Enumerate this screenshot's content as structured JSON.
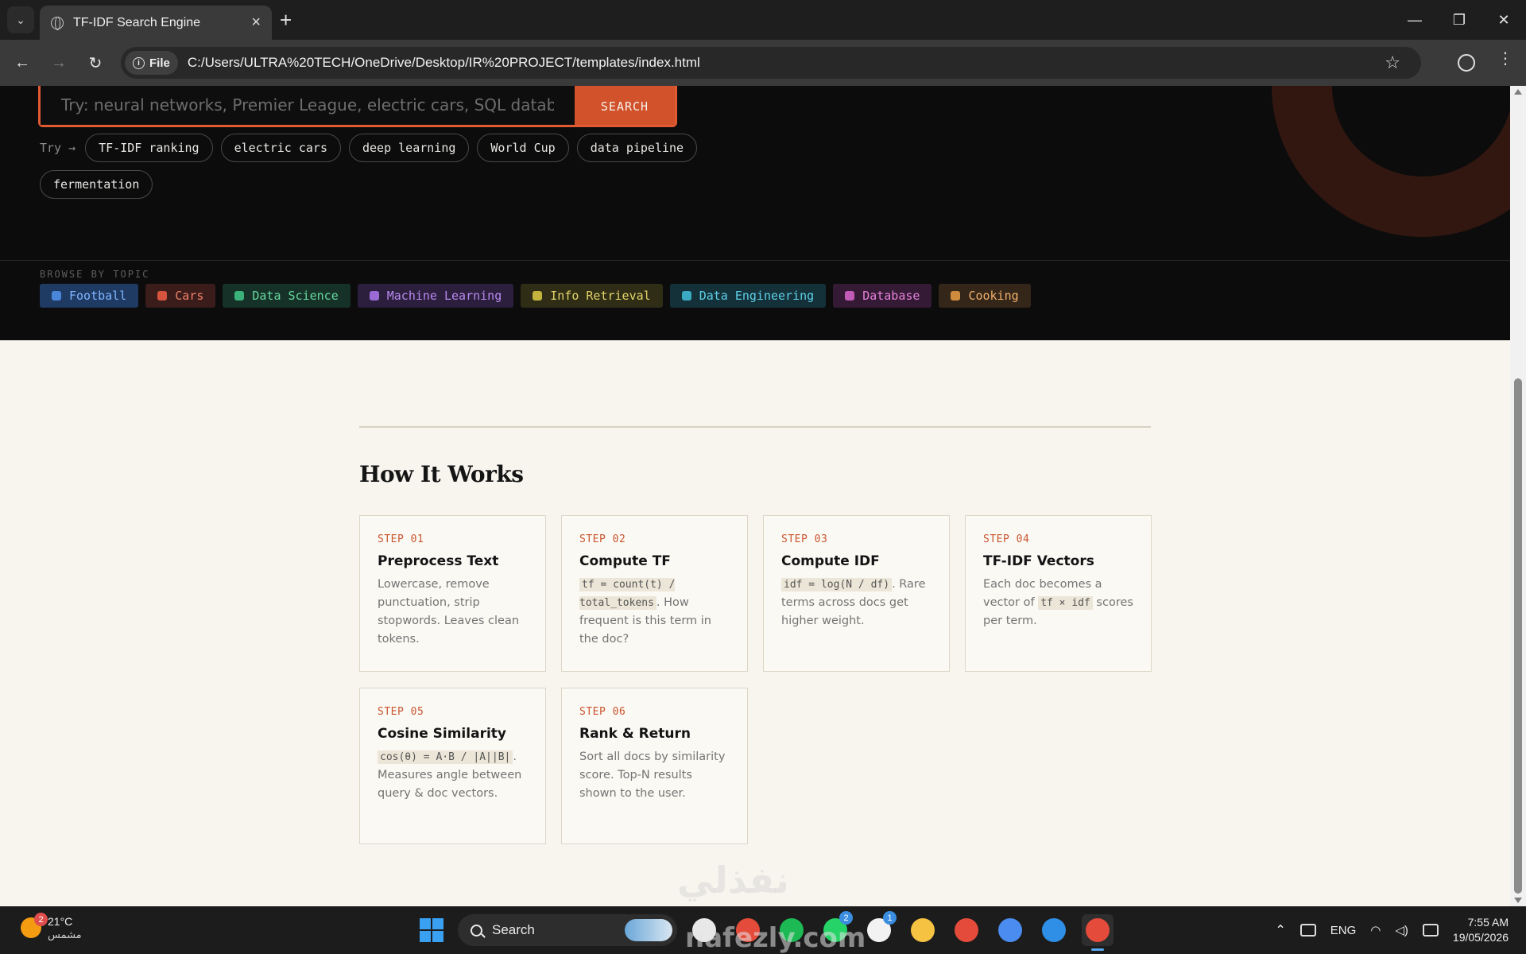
{
  "browser": {
    "tab_title": "TF-IDF Search Engine",
    "site_chip_label": "File",
    "url": "C:/Users/ULTRA%20TECH/OneDrive/Desktop/IR%20PROJECT/templates/index.html"
  },
  "search": {
    "placeholder": "Try: neural networks, Premier League, electric cars, SQL database...",
    "button_label": "SEARCH"
  },
  "try": {
    "label": "Try →",
    "chips": [
      "TF-IDF ranking",
      "electric cars",
      "deep learning",
      "World Cup",
      "data pipeline",
      "fermentation"
    ]
  },
  "browse": {
    "label": "BROWSE BY TOPIC",
    "topics": [
      {
        "label": "Football",
        "icon": "globe-icon",
        "bg": "#1f3a63",
        "fg": "#7fb6ff",
        "dot": "#4a86d9"
      },
      {
        "label": "Cars",
        "icon": "car-icon",
        "bg": "#3a1c1a",
        "fg": "#f0806a",
        "dot": "#d6543e"
      },
      {
        "label": "Data Science",
        "icon": "chart-icon",
        "bg": "#163228",
        "fg": "#67d89f",
        "dot": "#3bb27a"
      },
      {
        "label": "Machine Learning",
        "icon": "robot-icon",
        "bg": "#2c1f3d",
        "fg": "#b889ef",
        "dot": "#9a6ad6"
      },
      {
        "label": "Info Retrieval",
        "icon": "magnifier-icon",
        "bg": "#2f2d16",
        "fg": "#e4d46a",
        "dot": "#c4b43e"
      },
      {
        "label": "Data Engineering",
        "icon": "gear-icon",
        "bg": "#14313a",
        "fg": "#5ed0e6",
        "dot": "#3aa9c2"
      },
      {
        "label": "Database",
        "icon": "database-icon",
        "bg": "#351a35",
        "fg": "#e482d9",
        "dot": "#c25bb7"
      },
      {
        "label": "Cooking",
        "icon": "pan-icon",
        "bg": "#35261a",
        "fg": "#f0b06a",
        "dot": "#d08c3e"
      }
    ]
  },
  "how": {
    "title": "How It Works",
    "steps": [
      {
        "num": "STEP 01",
        "title": "Preprocess Text",
        "parts": [
          {
            "t": "Lowercase, remove punctuation, strip stopwords. Leaves clean tokens."
          }
        ]
      },
      {
        "num": "STEP 02",
        "title": "Compute TF",
        "parts": [
          {
            "code": "tf = count(t) / total_tokens"
          },
          {
            "t": ". How frequent is this term in the doc?"
          }
        ]
      },
      {
        "num": "STEP 03",
        "title": "Compute IDF",
        "parts": [
          {
            "code": "idf = log(N / df)"
          },
          {
            "t": ". Rare terms across docs get higher weight."
          }
        ]
      },
      {
        "num": "STEP 04",
        "title": "TF-IDF Vectors",
        "parts": [
          {
            "t": "Each doc becomes a vector of "
          },
          {
            "code": "tf × idf"
          },
          {
            "t": " scores per term."
          }
        ]
      },
      {
        "num": "STEP 05",
        "title": "Cosine Similarity",
        "parts": [
          {
            "code": "cos(θ) = A·B / |A||B|"
          },
          {
            "t": ". Measures angle between query & doc vectors."
          }
        ]
      },
      {
        "num": "STEP 06",
        "title": "Rank & Return",
        "parts": [
          {
            "t": "Sort all docs by similarity score. Top-N results shown to the user."
          }
        ]
      }
    ]
  },
  "watermark": {
    "arabic": "نفذلي",
    "latin": "nafezly.com"
  },
  "taskbar": {
    "temperature": "21°C",
    "weather_desc": "مشمس",
    "weather_badge": "2",
    "search_label": "Search",
    "apps": [
      {
        "icon": "file-explorer-icon",
        "color": "#e8e8e8",
        "badge": ""
      },
      {
        "icon": "chrome-icon",
        "color": "#e44b3a",
        "badge": ""
      },
      {
        "icon": "spotify-icon",
        "color": "#1db954",
        "badge": ""
      },
      {
        "icon": "whatsapp-icon",
        "color": "#25d366",
        "badge": "2"
      },
      {
        "icon": "store-icon",
        "color": "#f2f2f2",
        "badge": "1"
      },
      {
        "icon": "folder-icon",
        "color": "#f5c242",
        "badge": ""
      },
      {
        "icon": "chrome-profile-icon",
        "color": "#e44b3a",
        "badge": ""
      },
      {
        "icon": "chrome-profile2-icon",
        "color": "#4a8cf0",
        "badge": ""
      },
      {
        "icon": "vscode-icon",
        "color": "#2f8fe6",
        "badge": ""
      },
      {
        "icon": "chrome-active-icon",
        "color": "#e44b3a",
        "badge": "",
        "active": true
      }
    ],
    "language": "ENG",
    "time": "7:55 AM",
    "date": "19/05/2026"
  }
}
